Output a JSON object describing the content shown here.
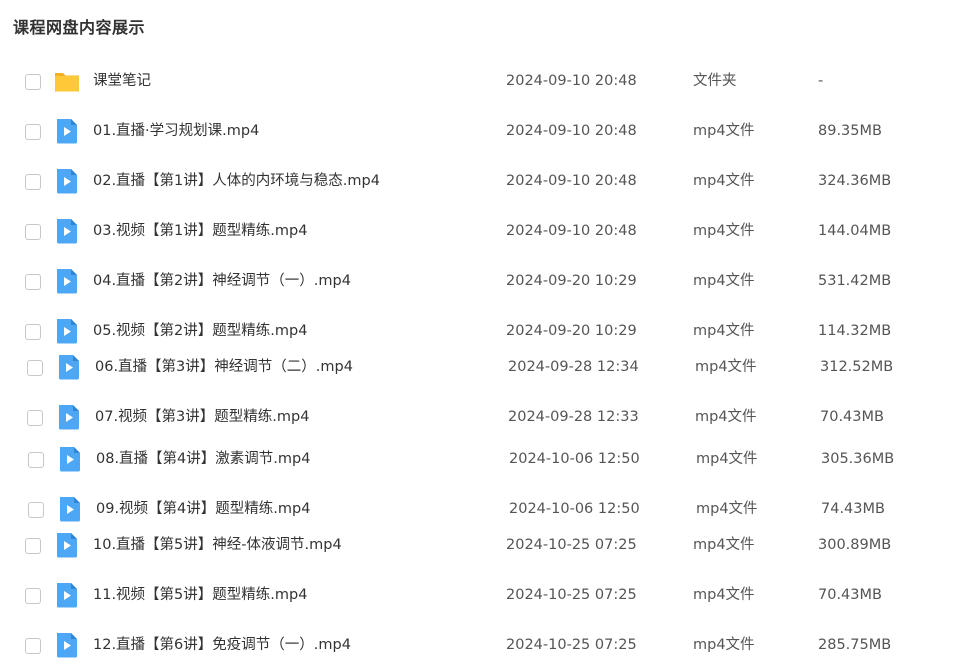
{
  "page": {
    "title": "课程网盘内容展示"
  },
  "files": [
    {
      "name": "课堂笔记",
      "date": "2024-09-10 20:48",
      "type": "文件夹",
      "size": "-",
      "icon": "folder-icon"
    },
    {
      "name": "01.直播·学习规划课.mp4",
      "date": "2024-09-10 20:48",
      "type": "mp4文件",
      "size": "89.35MB",
      "icon": "video-file-icon"
    },
    {
      "name": "02.直播【第1讲】人体的内环境与稳态.mp4",
      "date": "2024-09-10 20:48",
      "type": "mp4文件",
      "size": "324.36MB",
      "icon": "video-file-icon"
    },
    {
      "name": "03.视频【第1讲】题型精练.mp4",
      "date": "2024-09-10 20:48",
      "type": "mp4文件",
      "size": "144.04MB",
      "icon": "video-file-icon"
    },
    {
      "name": "04.直播【第2讲】神经调节（一）.mp4",
      "date": "2024-09-20 10:29",
      "type": "mp4文件",
      "size": "531.42MB",
      "icon": "video-file-icon"
    },
    {
      "name": "05.视频【第2讲】题型精练.mp4",
      "date": "2024-09-20 10:29",
      "type": "mp4文件",
      "size": "114.32MB",
      "icon": "video-file-icon"
    },
    {
      "name": "06.直播【第3讲】神经调节（二）.mp4",
      "date": "2024-09-28 12:34",
      "type": "mp4文件",
      "size": "312.52MB",
      "icon": "video-file-icon"
    },
    {
      "name": "07.视频【第3讲】题型精练.mp4",
      "date": "2024-09-28 12:33",
      "type": "mp4文件",
      "size": "70.43MB",
      "icon": "video-file-icon"
    },
    {
      "name": "08.直播【第4讲】激素调节.mp4",
      "date": "2024-10-06 12:50",
      "type": "mp4文件",
      "size": "305.36MB",
      "icon": "video-file-icon"
    },
    {
      "name": "09.视频【第4讲】题型精练.mp4",
      "date": "2024-10-06 12:50",
      "type": "mp4文件",
      "size": "74.43MB",
      "icon": "video-file-icon"
    },
    {
      "name": "10.直播【第5讲】神经-体液调节.mp4",
      "date": "2024-10-25 07:25",
      "type": "mp4文件",
      "size": "300.89MB",
      "icon": "video-file-icon"
    },
    {
      "name": "11.视频【第5讲】题型精练.mp4",
      "date": "2024-10-25 07:25",
      "type": "mp4文件",
      "size": "70.43MB",
      "icon": "video-file-icon"
    },
    {
      "name": "12.直播【第6讲】免疫调节（一）.mp4",
      "date": "2024-10-25 07:25",
      "type": "mp4文件",
      "size": "285.75MB",
      "icon": "video-file-icon"
    }
  ],
  "colors": {
    "folder": "#FFC839",
    "video": "#4DA7F5",
    "text": "#333333",
    "meta": "#555555"
  }
}
